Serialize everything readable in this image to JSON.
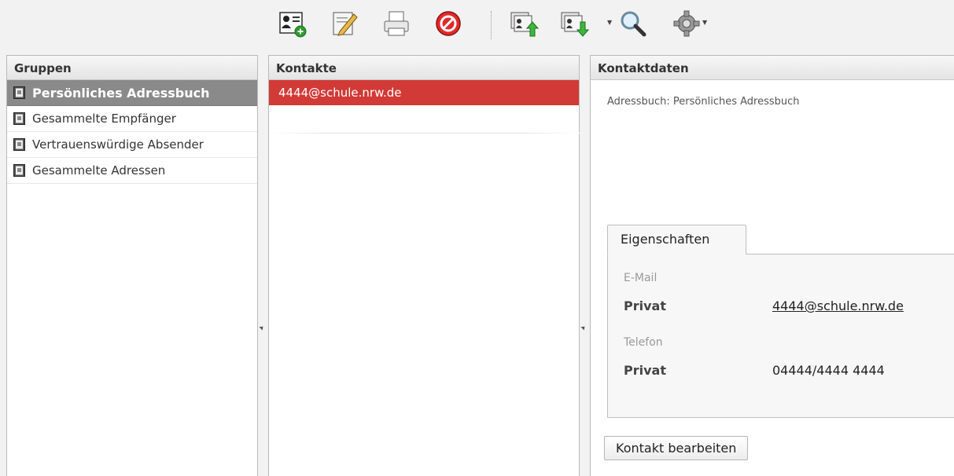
{
  "toolbar": {
    "buttons": [
      {
        "name": "add-contact",
        "icon": "contact-add-icon"
      },
      {
        "name": "edit",
        "icon": "pencil-icon"
      },
      {
        "name": "print",
        "icon": "printer-icon"
      },
      {
        "name": "delete",
        "icon": "delete-icon"
      },
      {
        "name": "import",
        "icon": "import-icon"
      },
      {
        "name": "export",
        "icon": "export-icon",
        "has_dropdown": true
      },
      {
        "name": "search",
        "icon": "search-icon"
      },
      {
        "name": "settings",
        "icon": "gear-icon",
        "has_dropdown": true
      }
    ]
  },
  "groups": {
    "header": "Gruppen",
    "items": [
      {
        "label": "Persönliches Adressbuch",
        "selected": true
      },
      {
        "label": "Gesammelte Empfänger",
        "selected": false
      },
      {
        "label": "Vertrauenswürdige Absender",
        "selected": false
      },
      {
        "label": "Gesammelte Adressen",
        "selected": false
      }
    ]
  },
  "contacts": {
    "header": "Kontakte",
    "items": [
      {
        "label": "4444@schule.nrw.de",
        "selected": true
      }
    ]
  },
  "details": {
    "header": "Kontaktdaten",
    "addressbook_line": "Adressbuch: Persönliches Adressbuch",
    "tab_label": "Eigenschaften",
    "email_section": "E-Mail",
    "email_type": "Privat",
    "email_value": "4444@schule.nrw.de",
    "phone_section": "Telefon",
    "phone_type": "Privat",
    "phone_value": "04444/4444 4444",
    "edit_button": "Kontakt bearbeiten"
  },
  "colors": {
    "selected_group_bg": "#8a8a8a",
    "selected_contact_bg": "#d13a36"
  }
}
